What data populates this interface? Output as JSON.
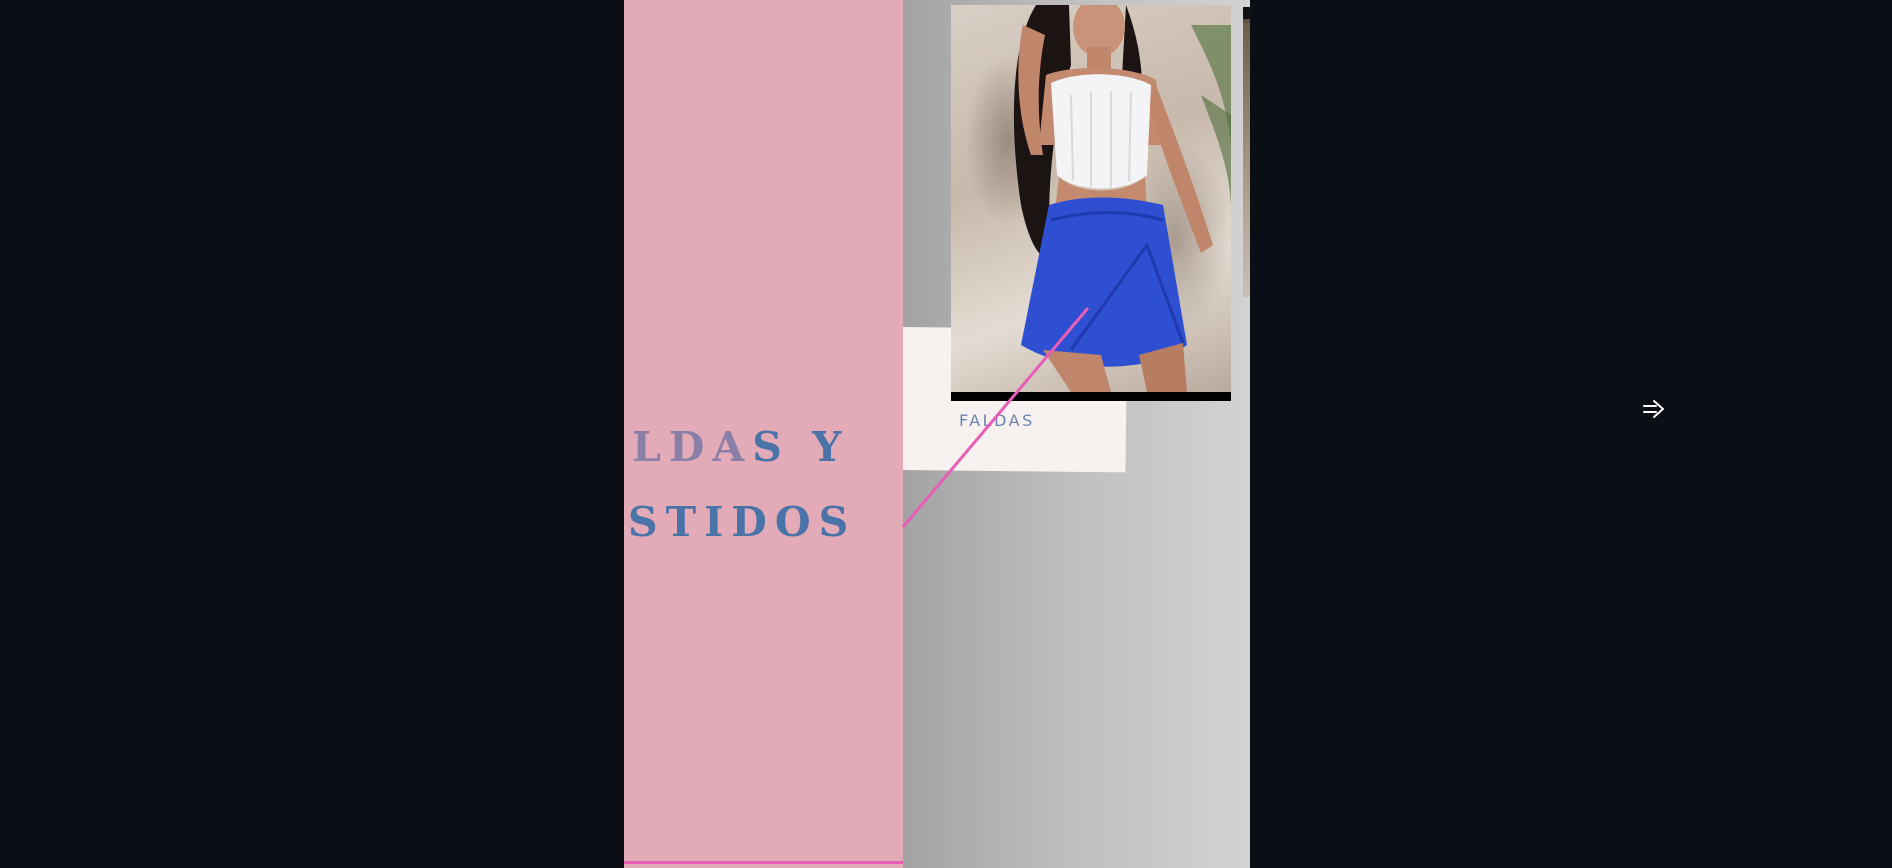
{
  "slide": {
    "title_line_1_fade": "LDA",
    "title_line_1_solid": "S Y",
    "title_line_2": "STIDOS",
    "caption": "FALDAS"
  },
  "colors": {
    "background": "#0b0e14",
    "pink_page": "#e3aab8",
    "accent_magenta": "#e85db8",
    "title_blue": "#4a73a8",
    "caption_blue": "#6d84b4"
  },
  "icons": {
    "next": "arrow-right-icon"
  }
}
